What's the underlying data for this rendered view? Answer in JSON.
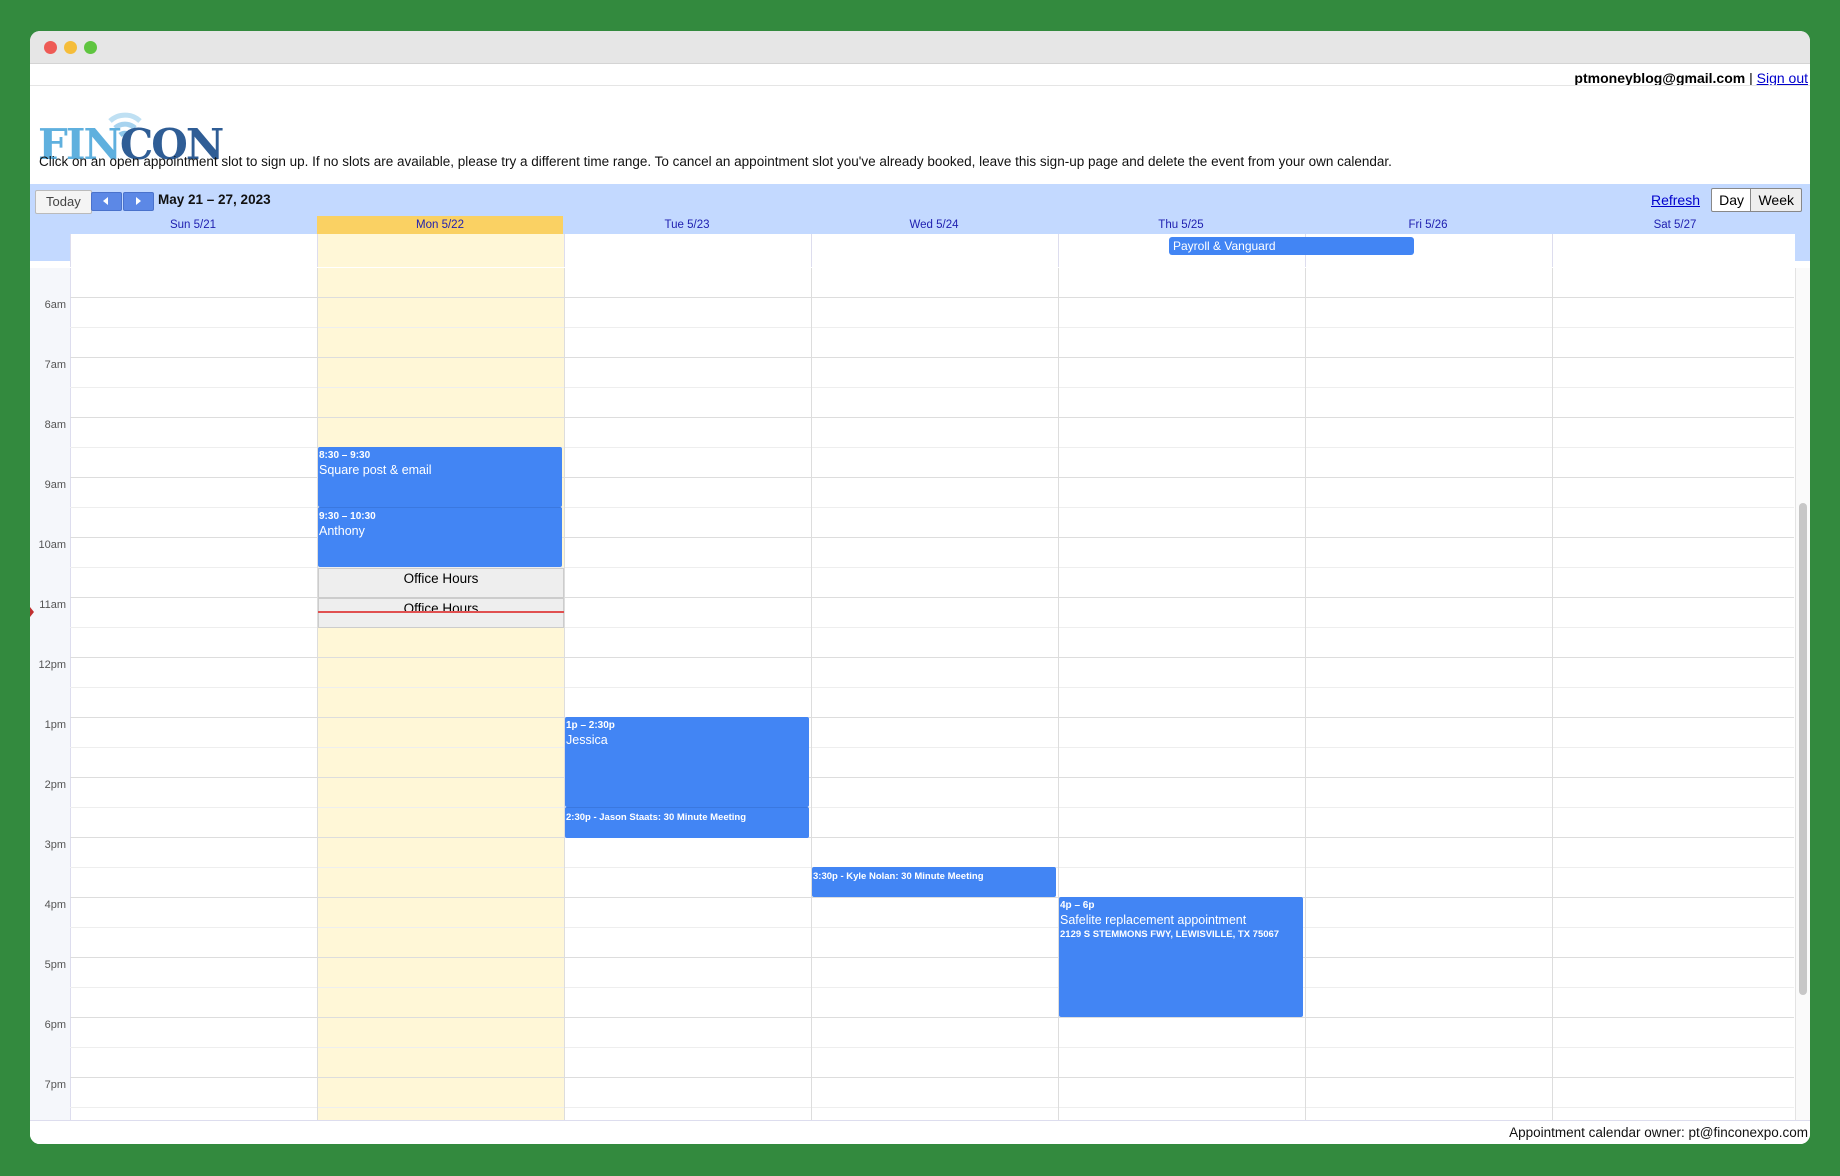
{
  "header": {
    "email": "ptmoneyblog@gmail.com",
    "separator": "|",
    "sign_out": "Sign out"
  },
  "logo": {
    "text": "FINCON"
  },
  "instructions": "Click on an open appointment slot to sign up. If no slots are available, please try a different time range. To cancel an appointment slot you've already booked, leave this sign-up page and delete the event from your own calendar.",
  "toolbar": {
    "today": "Today",
    "date_range": "May 21 – 27, 2023",
    "refresh": "Refresh",
    "day": "Day",
    "week": "Week"
  },
  "days": [
    "Sun 5/21",
    "Mon 5/22",
    "Tue 5/23",
    "Wed 5/24",
    "Thu 5/25",
    "Fri 5/26",
    "Sat 5/27"
  ],
  "all_day_event": "Payroll & Vanguard",
  "hours": [
    "6am",
    "7am",
    "8am",
    "9am",
    "10am",
    "11am",
    "12pm",
    "1pm",
    "2pm",
    "3pm",
    "4pm",
    "5pm",
    "6pm",
    "7pm"
  ],
  "events": {
    "square": {
      "time": "8:30 – 9:30",
      "title": "Square post & email"
    },
    "anthony": {
      "time": "9:30 – 10:30",
      "title": "Anthony"
    },
    "jessica": {
      "time": "1p – 2:30p",
      "title": "Jessica"
    },
    "jason": {
      "label": "2:30p - Jason Staats: 30 Minute Meeting"
    },
    "kyle": {
      "label": "3:30p - Kyle Nolan: 30 Minute Meeting"
    },
    "safelite": {
      "time": "4p – 6p",
      "title": "Safelite replacement appointment",
      "location": "2129 S STEMMONS FWY, LEWISVILLE, TX 75067"
    }
  },
  "slots": [
    "Office Hours",
    "Office Hours"
  ],
  "footer": "Appointment calendar owner: pt@finconexpo.com",
  "colors": {
    "event": "#4285f4",
    "today": "#fad163",
    "toolbar": "#c3d9ff",
    "background": "#338a3e"
  }
}
